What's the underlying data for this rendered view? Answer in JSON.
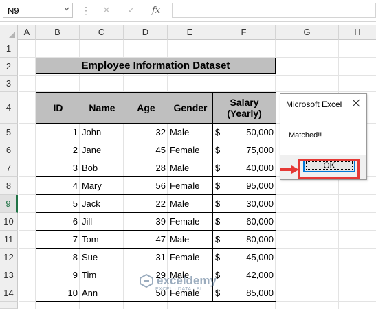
{
  "formula_bar": {
    "name_box": "N9",
    "cancel_glyph": "✕",
    "enter_glyph": "✓",
    "fx_label": "fx",
    "formula": ""
  },
  "columns": [
    "A",
    "B",
    "C",
    "D",
    "E",
    "F",
    "G",
    "H"
  ],
  "rows": [
    "1",
    "2",
    "3",
    "4",
    "5",
    "6",
    "7",
    "8",
    "9",
    "10",
    "11",
    "12",
    "13",
    "14"
  ],
  "selected_row": "9",
  "sheet": {
    "title": "Employee Information Dataset",
    "headers": {
      "id": "ID",
      "name": "Name",
      "age": "Age",
      "gender": "Gender",
      "salary_line1": "Salary",
      "salary_line2": "(Yearly)"
    },
    "currency": "$",
    "records": [
      {
        "id": "1",
        "name": "John",
        "age": "32",
        "gender": "Male",
        "salary": "50,000"
      },
      {
        "id": "2",
        "name": "Jane",
        "age": "45",
        "gender": "Female",
        "salary": "75,000"
      },
      {
        "id": "3",
        "name": "Bob",
        "age": "28",
        "gender": "Male",
        "salary": "40,000"
      },
      {
        "id": "4",
        "name": "Mary",
        "age": "56",
        "gender": "Female",
        "salary": "95,000"
      },
      {
        "id": "5",
        "name": "Jack",
        "age": "22",
        "gender": "Male",
        "salary": "30,000"
      },
      {
        "id": "6",
        "name": "Jill",
        "age": "39",
        "gender": "Female",
        "salary": "60,000"
      },
      {
        "id": "7",
        "name": "Tom",
        "age": "47",
        "gender": "Male",
        "salary": "80,000"
      },
      {
        "id": "8",
        "name": "Sue",
        "age": "31",
        "gender": "Female",
        "salary": "45,000"
      },
      {
        "id": "9",
        "name": "Tim",
        "age": "29",
        "gender": "Male",
        "salary": "42,000"
      },
      {
        "id": "10",
        "name": "Ann",
        "age": "50",
        "gender": "Female",
        "salary": "85,000"
      }
    ]
  },
  "dialog": {
    "title": "Microsoft Excel",
    "message": "Matched!!",
    "ok_label": "OK"
  },
  "watermark": {
    "name": "exceldemy",
    "tagline": "EXCEL · DATA · BI"
  },
  "colors": {
    "header_fill": "#bfbfbf",
    "excel_green": "#217346",
    "highlight_red": "#e53935",
    "focus_blue": "#0078d7"
  }
}
